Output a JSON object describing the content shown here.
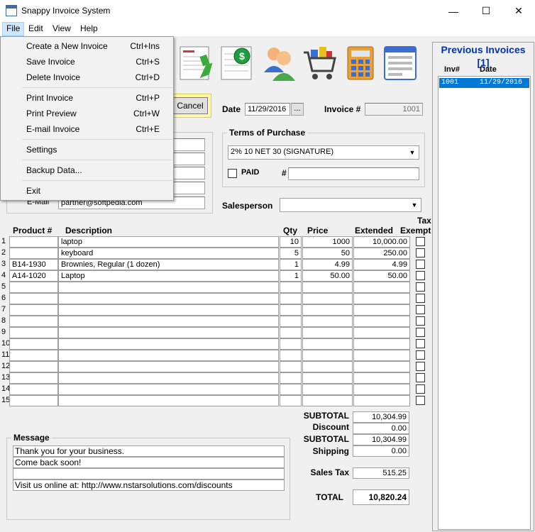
{
  "window": {
    "title": "Snappy Invoice System",
    "minimize": "—",
    "maximize": "☐",
    "close": "✕"
  },
  "menubar": {
    "file": "File",
    "edit": "Edit",
    "view": "View",
    "help": "Help"
  },
  "file_menu": {
    "items": [
      {
        "label": "Create a New Invoice",
        "shortcut": "Ctrl+Ins"
      },
      {
        "label": "Save Invoice",
        "shortcut": "Ctrl+S"
      },
      {
        "label": "Delete Invoice",
        "shortcut": "Ctrl+D"
      },
      {
        "label": "Print Invoice",
        "shortcut": "Ctrl+P"
      },
      {
        "label": "Print Preview",
        "shortcut": "Ctrl+W"
      },
      {
        "label": "E-mail Invoice",
        "shortcut": "Ctrl+E"
      },
      {
        "label": "Settings",
        "shortcut": ""
      },
      {
        "label": "Backup Data...",
        "shortcut": ""
      },
      {
        "label": "Exit",
        "shortcut": ""
      }
    ]
  },
  "header": {
    "cancel": "Cancel",
    "date_label": "Date",
    "date_value": "11/29/2016",
    "date_button": "...",
    "invoice_label": "Invoice #",
    "invoice_value": "1001"
  },
  "customer": {
    "email_label": "E-Mail",
    "email_value": "partner@softpedia.com"
  },
  "terms": {
    "title": "Terms of Purchase",
    "selected": "2% 10 NET 30 (SIGNATURE)",
    "paid_label": "PAID",
    "number_label": "#"
  },
  "salesperson": {
    "label": "Salesperson",
    "value": ""
  },
  "table": {
    "headers": {
      "product": "Product #",
      "description": "Description",
      "qty": "Qty",
      "price": "Price",
      "extended": "Extended",
      "tax_line1": "Tax",
      "tax_line2": "Exempt"
    },
    "rows": [
      {
        "num": "1",
        "product": "",
        "description": "laptop",
        "qty": "10",
        "price": "1000",
        "extended": "10,000.00"
      },
      {
        "num": "2",
        "product": "",
        "description": "keyboard",
        "qty": "5",
        "price": "50",
        "extended": "250.00"
      },
      {
        "num": "3",
        "product": "B14-1930",
        "description": "Brownies, Regular (1 dozen)",
        "qty": "1",
        "price": "4.99",
        "extended": "4.99"
      },
      {
        "num": "4",
        "product": "A14-1020",
        "description": "Laptop",
        "qty": "1",
        "price": "50.00",
        "extended": "50.00"
      },
      {
        "num": "5",
        "product": "",
        "description": "",
        "qty": "",
        "price": "",
        "extended": ""
      },
      {
        "num": "6",
        "product": "",
        "description": "",
        "qty": "",
        "price": "",
        "extended": ""
      },
      {
        "num": "7",
        "product": "",
        "description": "",
        "qty": "",
        "price": "",
        "extended": ""
      },
      {
        "num": "8",
        "product": "",
        "description": "",
        "qty": "",
        "price": "",
        "extended": ""
      },
      {
        "num": "9",
        "product": "",
        "description": "",
        "qty": "",
        "price": "",
        "extended": ""
      },
      {
        "num": "10",
        "product": "",
        "description": "",
        "qty": "",
        "price": "",
        "extended": ""
      },
      {
        "num": "11",
        "product": "",
        "description": "",
        "qty": "",
        "price": "",
        "extended": ""
      },
      {
        "num": "12",
        "product": "",
        "description": "",
        "qty": "",
        "price": "",
        "extended": ""
      },
      {
        "num": "13",
        "product": "",
        "description": "",
        "qty": "",
        "price": "",
        "extended": ""
      },
      {
        "num": "14",
        "product": "",
        "description": "",
        "qty": "",
        "price": "",
        "extended": ""
      },
      {
        "num": "15",
        "product": "",
        "description": "",
        "qty": "",
        "price": "",
        "extended": ""
      }
    ]
  },
  "totals": {
    "subtotal_label": "SUBTOTAL",
    "subtotal": "10,304.99",
    "discount_label": "Discount",
    "discount": "0.00",
    "subtotal2_label": "SUBTOTAL",
    "subtotal2": "10,304.99",
    "shipping_label": "Shipping",
    "shipping": "0.00",
    "tax_label": "Sales Tax",
    "tax": "515.25",
    "total_label": "TOTAL",
    "total": "10,820.24"
  },
  "message": {
    "title": "Message",
    "lines": [
      "Thank you for your business.",
      "Come back soon!",
      "",
      "Visit us online at: http://www.nstarsolutions.com/discounts"
    ]
  },
  "previous": {
    "title": "Previous Invoices",
    "page": "[1]",
    "col_inv": "Inv#",
    "col_date": "Date",
    "rows": [
      {
        "inv": "1001",
        "date": "11/29/2016"
      }
    ]
  },
  "colors": {
    "accent": "#0033aa",
    "selection": "#0078d7",
    "highlight": "#fff9a8"
  }
}
